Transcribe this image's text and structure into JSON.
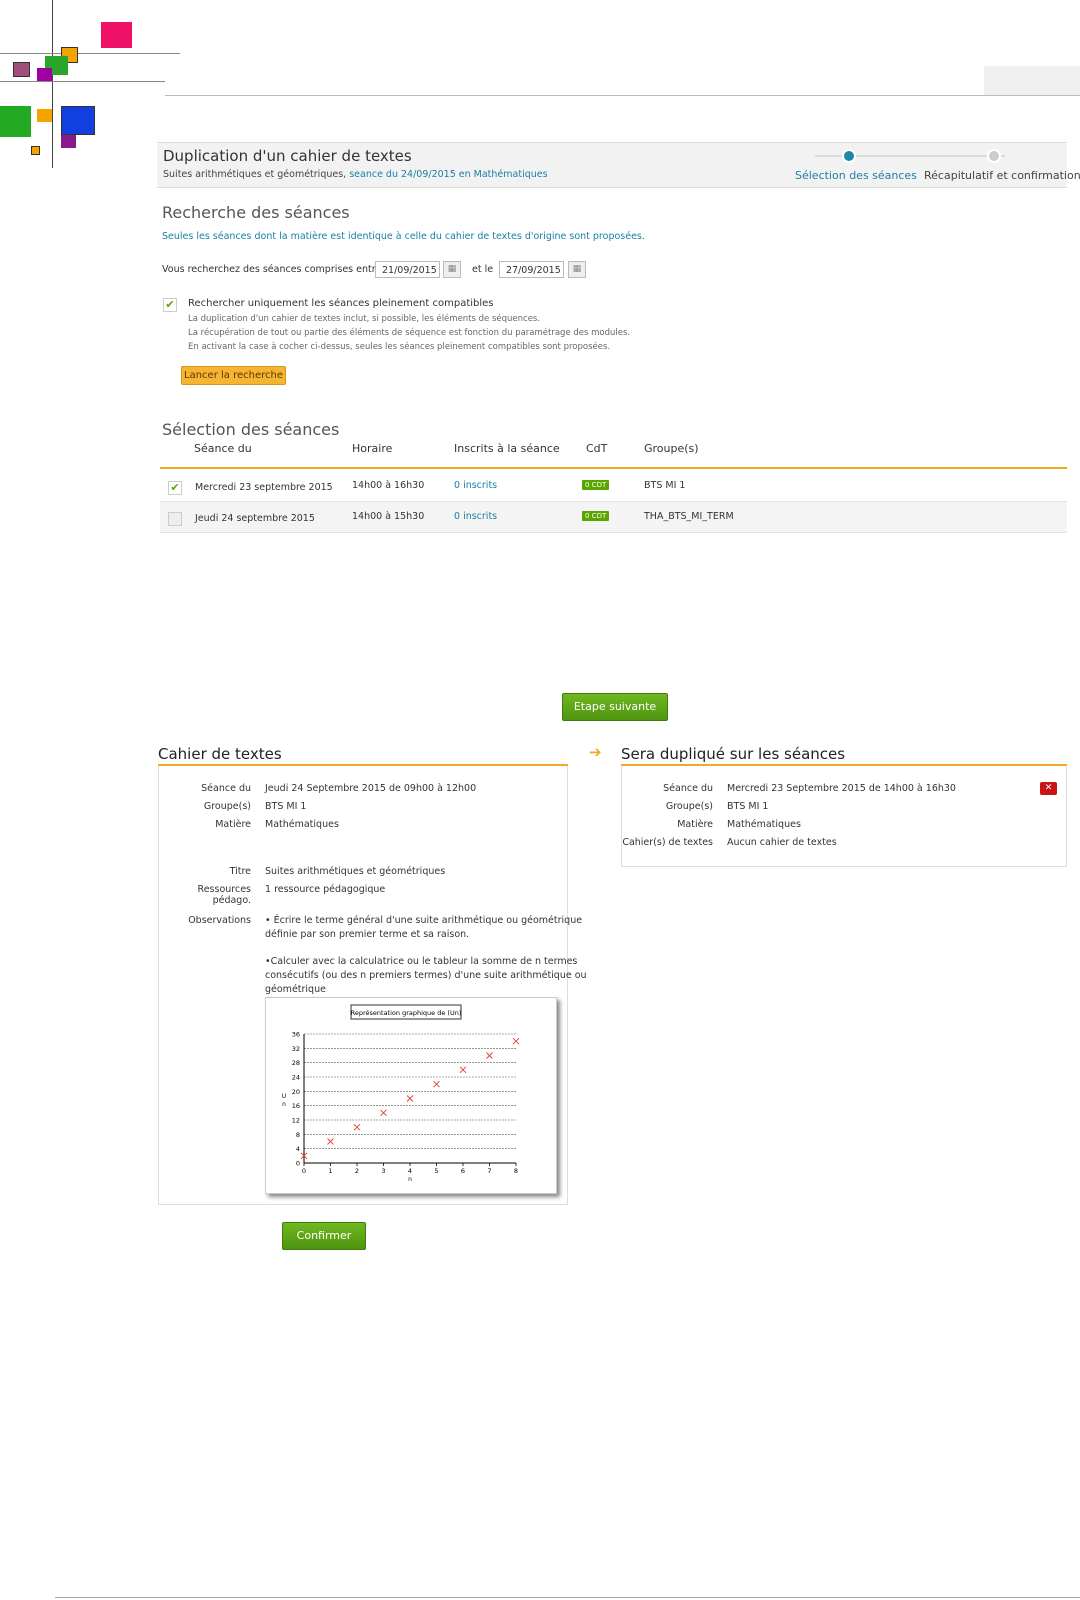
{
  "colors": {
    "accent_link": "#1a7fa6",
    "orange": "#f5a623",
    "green": "#5aa500",
    "delete_red": "#c81414"
  },
  "header": {
    "title": "Duplication d'un cahier de textes",
    "subtitle_plain": "Suites arithmétiques et géométriques, ",
    "subtitle_link": "seance du 24/09/2015 en Mathématiques",
    "steps": [
      {
        "label": "Sélection des séances",
        "active": true
      },
      {
        "label": "Récapitulatif et confirmation",
        "active": false
      }
    ]
  },
  "search": {
    "title": "Recherche des séances",
    "info": "Seules les séances dont la matière est identique à celle du cahier de textes d'origine sont proposées.",
    "range_label": "Vous recherchez des séances comprises entre le",
    "date_from": "21/09/2015",
    "and_label": "et le",
    "date_to": "27/09/2015",
    "compat_label": "Rechercher uniquement les séances pleinement compatibles",
    "compat_checked": true,
    "help_lines": [
      "La duplication d'un cahier de textes inclut, si possible, les éléments de séquences.",
      "La récupération de tout ou partie des éléments de séquence est fonction du paramétrage des modules.",
      "En activant la case à cocher ci-dessus, seules les séances pleinement compatibles sont proposées."
    ],
    "search_button": "Lancer la recherche"
  },
  "selection": {
    "title": "Sélection des séances",
    "columns": [
      "Séance du",
      "Horaire",
      "Inscrits à la séance",
      "CdT",
      "Groupe(s)"
    ],
    "rows": [
      {
        "checked": true,
        "date": "Mercredi 23 septembre 2015",
        "time": "14h00 à 16h30",
        "inscrits": "0 inscrits",
        "cdt": "0 CDT",
        "groupe": "BTS MI 1"
      },
      {
        "checked": false,
        "date": "Jeudi 24 septembre 2015",
        "time": "14h00 à 15h30",
        "inscrits": "0 inscrits",
        "cdt": "0 CDT",
        "groupe": "THA_BTS_MI_TERM"
      }
    ]
  },
  "next_button": "Etape suivante",
  "source": {
    "title": "Cahier de textes",
    "labels": {
      "seance": "Séance du",
      "groupes": "Groupe(s)",
      "matiere": "Matière",
      "titre": "Titre",
      "ressources": "Ressources pédago.",
      "observations": "Observations"
    },
    "seance": "Jeudi 24 Septembre 2015 de 09h00 à 12h00",
    "groupes": "BTS MI 1",
    "matiere": "Mathématiques",
    "titre": "Suites arithmétiques et géométriques",
    "ressources": "1 ressource pédagogique",
    "obs_1a": "• Écrire le terme général d'une suite arithmétique ou géométrique",
    "obs_1b": "définie par son premier terme et sa raison.",
    "obs_2a": "•Calculer avec la calculatrice ou le tableur la somme de n termes",
    "obs_2b": "consécutifs (ou des n premiers termes) d'une suite arithmétique ou",
    "obs_2c": "géométrique"
  },
  "target": {
    "title": "Sera dupliqué sur les séances",
    "labels": {
      "seance": "Séance du",
      "groupes": "Groupe(s)",
      "matiere": "Matière",
      "cahiers": "Cahier(s) de textes"
    },
    "seance": "Mercredi 23 Septembre 2015 de 14h00 à 16h30",
    "groupes": "BTS MI 1",
    "matiere": "Mathématiques",
    "cahiers": "Aucun cahier de textes"
  },
  "confirm_button": "Confirmer",
  "chart_data": {
    "type": "scatter",
    "title": "Représentation graphique de (Un)",
    "xlabel": "n",
    "ylabel": "U n",
    "x": [
      0,
      1,
      2,
      3,
      4,
      5,
      6,
      7,
      8
    ],
    "y": [
      2,
      6,
      10,
      14,
      18,
      22,
      26,
      30,
      34
    ],
    "xlim": [
      0,
      8
    ],
    "ylim": [
      0,
      36
    ],
    "xticks": [
      0,
      1,
      2,
      3,
      4,
      5,
      6,
      7,
      8
    ],
    "yticks": [
      0,
      4,
      8,
      12,
      16,
      20,
      24,
      28,
      32,
      36
    ],
    "grid": true,
    "marker_color": "#e04030"
  }
}
